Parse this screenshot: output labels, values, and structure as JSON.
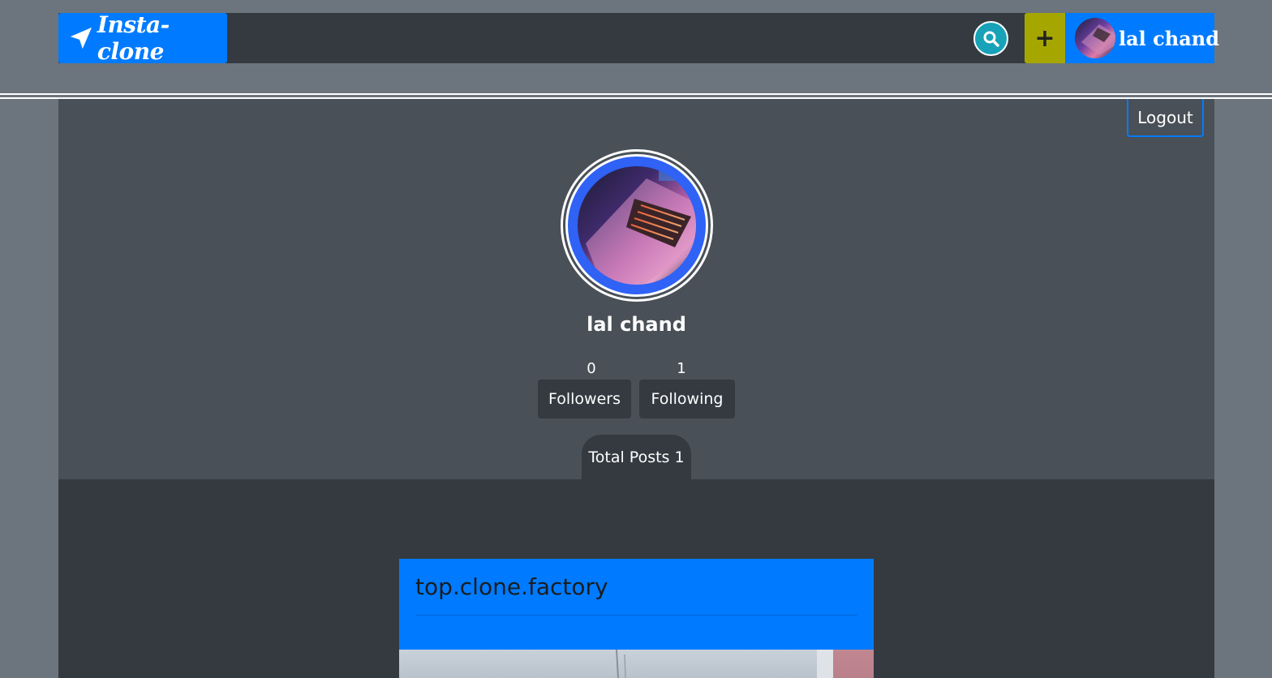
{
  "navbar": {
    "brand": "Insta-clone",
    "search_icon": "search-icon",
    "add_label": "+",
    "username": "lal chand",
    "colors": {
      "brand": "#007bff",
      "search": "#17a2b8",
      "add": "#a6a600",
      "dark": "#343a40"
    }
  },
  "profile": {
    "logout_label": "Logout",
    "name": "lal chand",
    "followers_count": "0",
    "followers_label": "Followers",
    "following_count": "1",
    "following_label": "Following",
    "total_posts_label": "Total Posts 1"
  },
  "posts": [
    {
      "username": "top.clone.factory"
    }
  ]
}
